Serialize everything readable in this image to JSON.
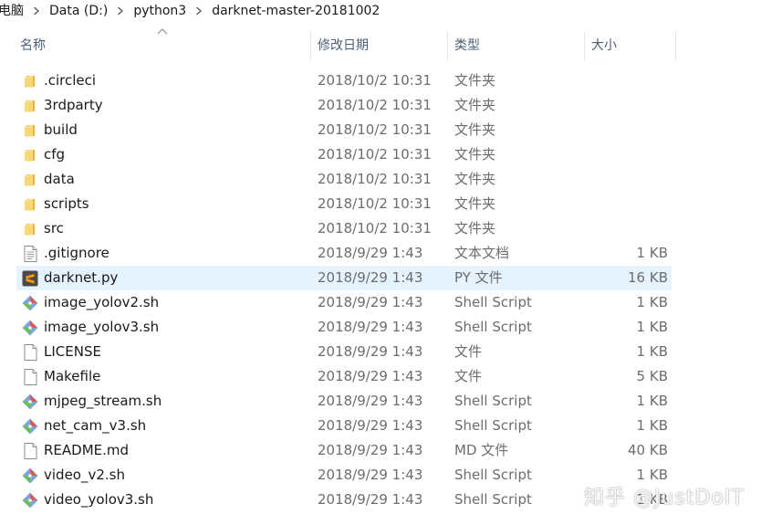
{
  "breadcrumb": [
    "电脑",
    "Data (D:)",
    "python3",
    "darknet-master-20181002"
  ],
  "columns": {
    "name": "名称",
    "date": "修改日期",
    "type": "类型",
    "size": "大小"
  },
  "files": [
    {
      "name": ".circleci",
      "date": "2018/10/2 10:31",
      "type": "文件夹",
      "size": "",
      "icon": "folder-icon"
    },
    {
      "name": "3rdparty",
      "date": "2018/10/2 10:31",
      "type": "文件夹",
      "size": "",
      "icon": "folder-icon"
    },
    {
      "name": "build",
      "date": "2018/10/2 10:31",
      "type": "文件夹",
      "size": "",
      "icon": "folder-icon"
    },
    {
      "name": "cfg",
      "date": "2018/10/2 10:31",
      "type": "文件夹",
      "size": "",
      "icon": "folder-icon"
    },
    {
      "name": "data",
      "date": "2018/10/2 10:31",
      "type": "文件夹",
      "size": "",
      "icon": "folder-icon"
    },
    {
      "name": "scripts",
      "date": "2018/10/2 10:31",
      "type": "文件夹",
      "size": "",
      "icon": "folder-icon"
    },
    {
      "name": "src",
      "date": "2018/10/2 10:31",
      "type": "文件夹",
      "size": "",
      "icon": "folder-icon"
    },
    {
      "name": ".gitignore",
      "date": "2018/9/29 1:43",
      "type": "文本文档",
      "size": "1 KB",
      "icon": "text-document-icon"
    },
    {
      "name": "darknet.py",
      "date": "2018/9/29 1:43",
      "type": "PY 文件",
      "size": "16 KB",
      "icon": "sublime-text-icon"
    },
    {
      "name": "image_yolov2.sh",
      "date": "2018/9/29 1:43",
      "type": "Shell Script",
      "size": "1 KB",
      "icon": "shell-script-icon"
    },
    {
      "name": "image_yolov3.sh",
      "date": "2018/9/29 1:43",
      "type": "Shell Script",
      "size": "1 KB",
      "icon": "shell-script-icon"
    },
    {
      "name": "LICENSE",
      "date": "2018/9/29 1:43",
      "type": "文件",
      "size": "1 KB",
      "icon": "blank-file-icon"
    },
    {
      "name": "Makefile",
      "date": "2018/9/29 1:43",
      "type": "文件",
      "size": "5 KB",
      "icon": "blank-file-icon"
    },
    {
      "name": "mjpeg_stream.sh",
      "date": "2018/9/29 1:43",
      "type": "Shell Script",
      "size": "1 KB",
      "icon": "shell-script-icon"
    },
    {
      "name": "net_cam_v3.sh",
      "date": "2018/9/29 1:43",
      "type": "Shell Script",
      "size": "1 KB",
      "icon": "shell-script-icon"
    },
    {
      "name": "README.md",
      "date": "2018/9/29 1:43",
      "type": "MD 文件",
      "size": "40 KB",
      "icon": "blank-file-icon"
    },
    {
      "name": "video_v2.sh",
      "date": "2018/9/29 1:43",
      "type": "Shell Script",
      "size": "1 KB",
      "icon": "shell-script-icon"
    },
    {
      "name": "video_yolov3.sh",
      "date": "2018/9/29 1:43",
      "type": "Shell Script",
      "size": "1 KB",
      "icon": "shell-script-icon"
    }
  ],
  "selected_file": "darknet.py",
  "watermark": "知乎 @JustDoIT",
  "colors": {
    "selection": "#e5f3ff",
    "folder": "#f8d775",
    "header_text": "#4c607a",
    "secondary_text": "#6d6d6d"
  }
}
